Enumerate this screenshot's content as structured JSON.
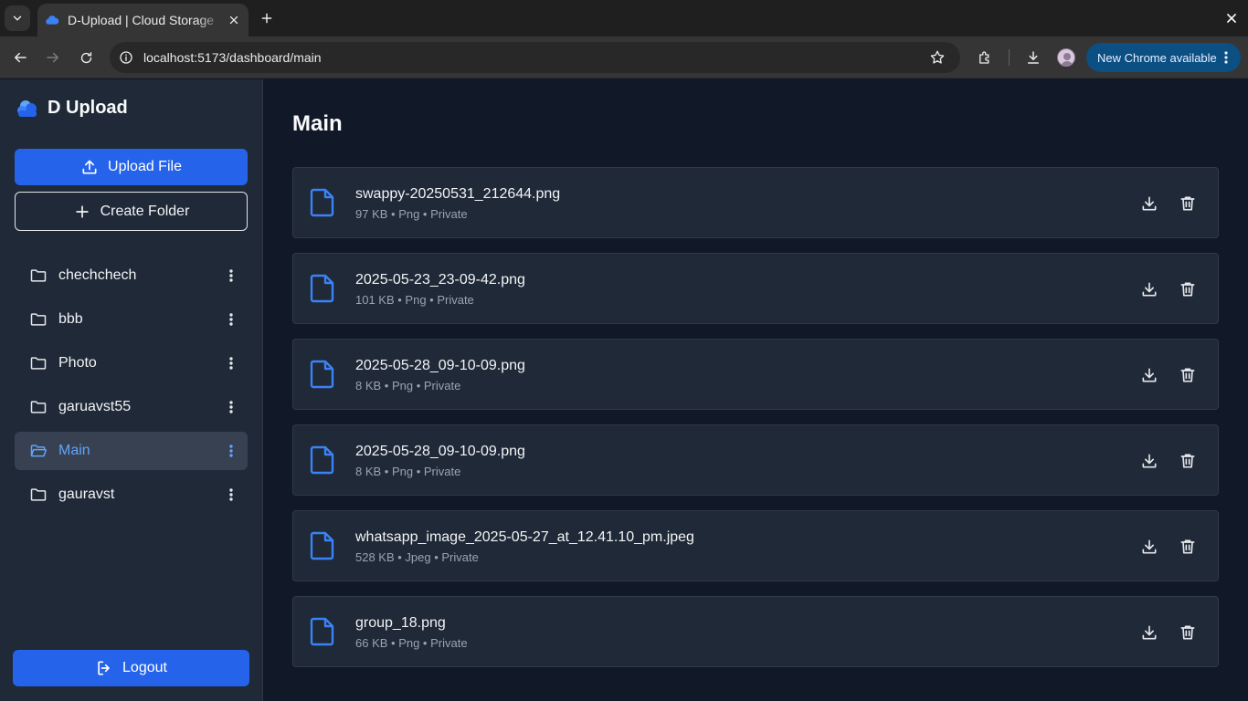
{
  "browser": {
    "tab_title": "D-Upload | Cloud Storage",
    "url": "localhost:5173/dashboard/main",
    "update_label": "New Chrome available"
  },
  "app": {
    "brand": "D Upload",
    "upload_label": "Upload File",
    "create_folder_label": "Create Folder",
    "logout_label": "Logout",
    "accent_color": "#2563eb",
    "active_color": "#60a5fa"
  },
  "folders": [
    {
      "label": "chechchech",
      "active": false
    },
    {
      "label": "bbb",
      "active": false
    },
    {
      "label": "Photo",
      "active": false
    },
    {
      "label": "garuavst55",
      "active": false
    },
    {
      "label": "Main",
      "active": true
    },
    {
      "label": "gauravst",
      "active": false
    }
  ],
  "main": {
    "title": "Main",
    "files": [
      {
        "name": "swappy-20250531_212644.png",
        "meta": "97 KB • Png • Private"
      },
      {
        "name": "2025-05-23_23-09-42.png",
        "meta": "101 KB • Png • Private"
      },
      {
        "name": "2025-05-28_09-10-09.png",
        "meta": "8 KB • Png • Private"
      },
      {
        "name": "2025-05-28_09-10-09.png",
        "meta": "8 KB • Png • Private"
      },
      {
        "name": "whatsapp_image_2025-05-27_at_12.41.10_pm.jpeg",
        "meta": "528 KB • Jpeg • Private"
      },
      {
        "name": "group_18.png",
        "meta": "66 KB • Png • Private"
      }
    ]
  }
}
